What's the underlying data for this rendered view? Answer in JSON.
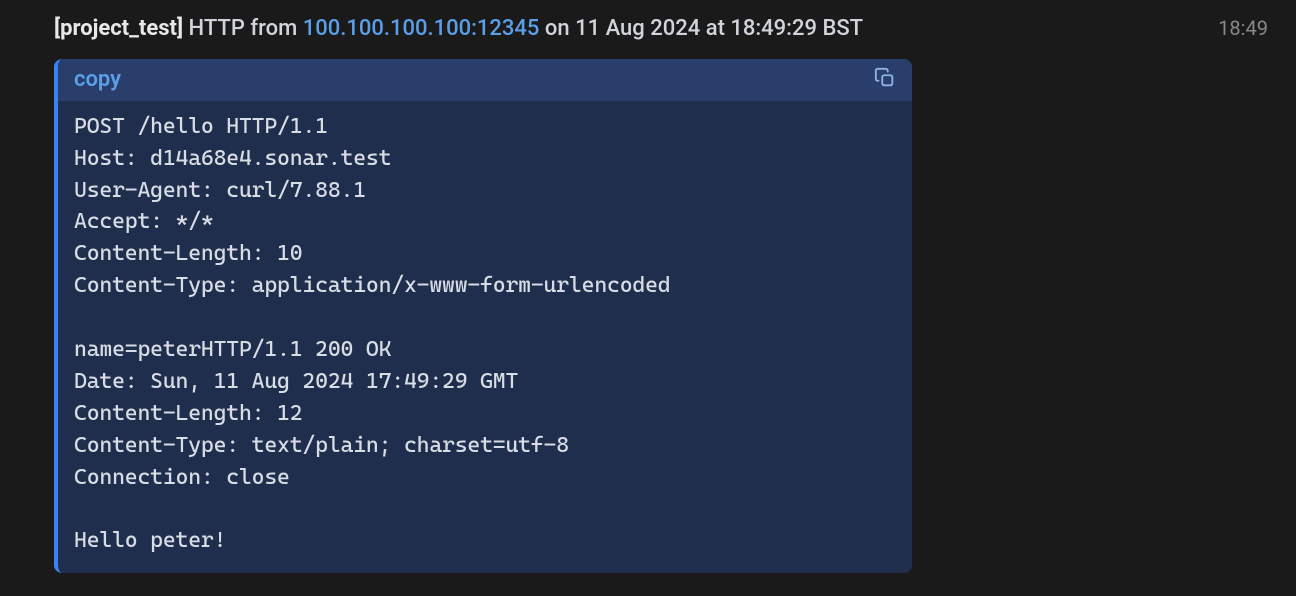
{
  "header": {
    "project_label": "[project_test]",
    "protocol_from": " HTTP from ",
    "ip_port": "100.100.100.100:12345",
    "date_text": " on 11 Aug 2024 at 18:49:29 BST"
  },
  "timestamp": "18:49",
  "code_block": {
    "copy_label": "copy",
    "content": "POST /hello HTTP/1.1\nHost: d14a68e4.sonar.test\nUser-Agent: curl/7.88.1\nAccept: */*\nContent-Length: 10\nContent-Type: application/x-www-form-urlencoded\n\nname=peterHTTP/1.1 200 OK\nDate: Sun, 11 Aug 2024 17:49:29 GMT\nContent-Length: 12\nContent-Type: text/plain; charset=utf-8\nConnection: close\n\nHello peter!"
  }
}
